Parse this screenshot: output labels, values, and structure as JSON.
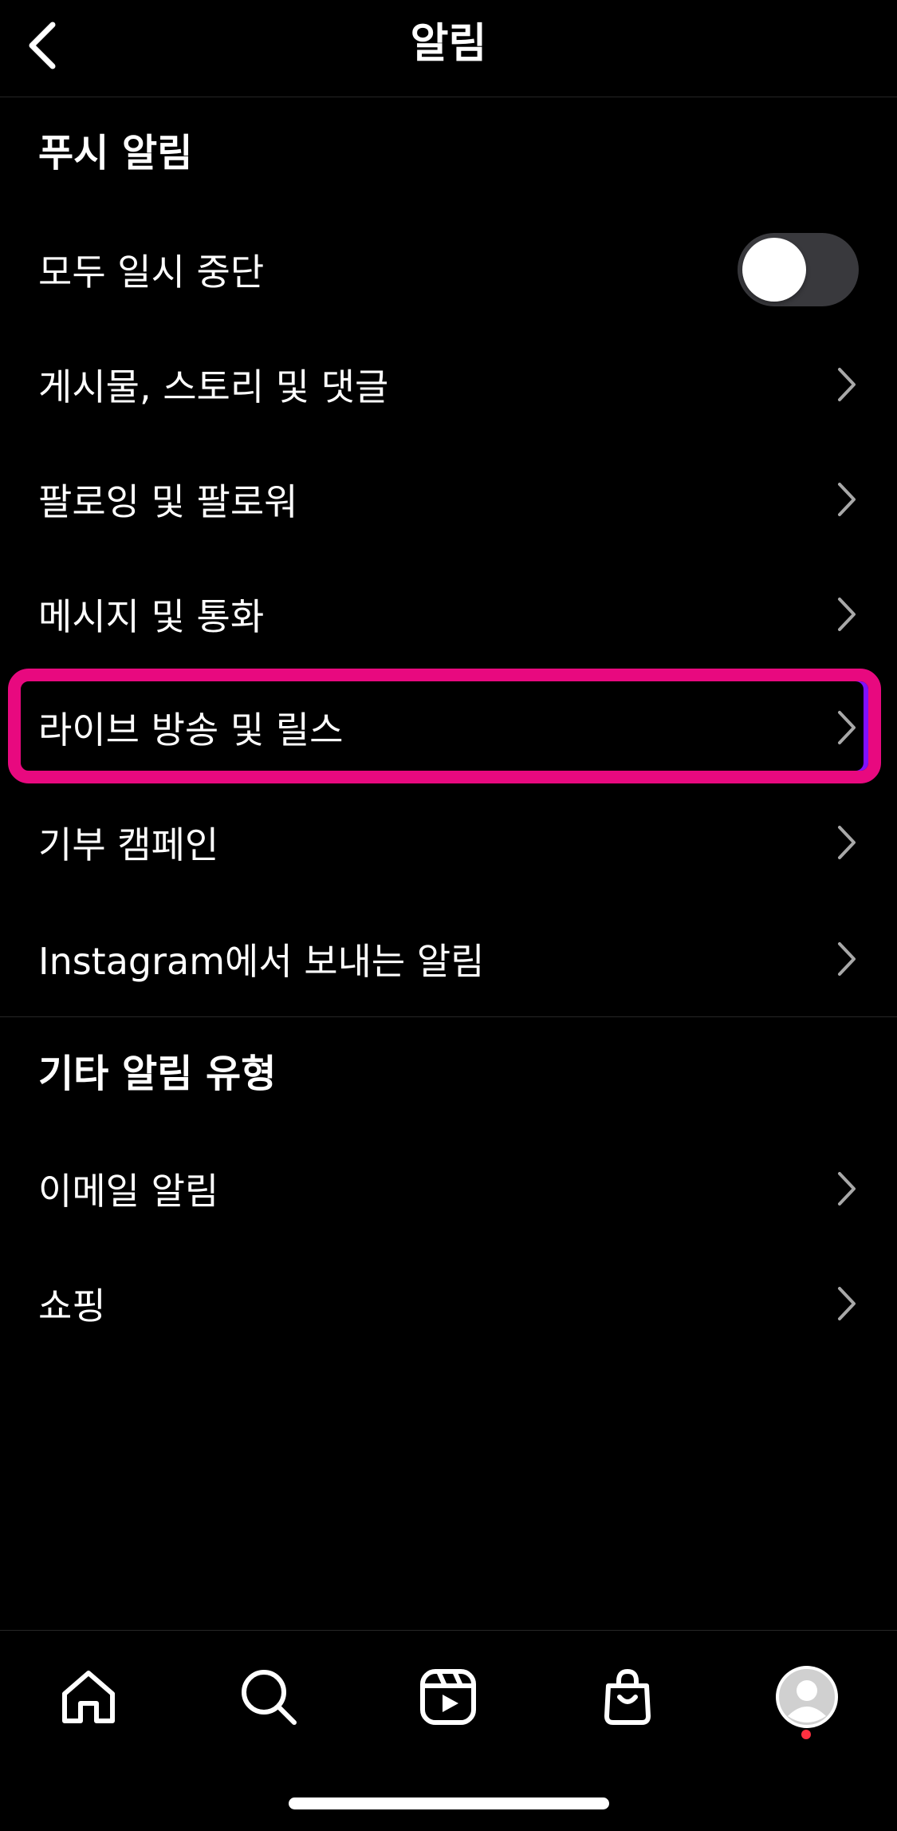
{
  "header": {
    "title": "알림"
  },
  "sections": {
    "push": {
      "title": "푸시 알림",
      "pause_all_label": "모두 일시 중단",
      "pause_all_on": false,
      "items": [
        {
          "label": "게시물, 스토리 및 댓글"
        },
        {
          "label": "팔로잉 및 팔로워"
        },
        {
          "label": "메시지 및 통화"
        },
        {
          "label": "라이브 방송 및 릴스"
        },
        {
          "label": "기부 캠페인"
        },
        {
          "label": "Instagram에서 보내는 알림"
        }
      ]
    },
    "other": {
      "title": "기타 알림 유형",
      "items": [
        {
          "label": "이메일 알림"
        },
        {
          "label": "쇼핑"
        }
      ]
    }
  },
  "tabbar": {
    "tabs": [
      {
        "icon": "home-icon"
      },
      {
        "icon": "search-icon"
      },
      {
        "icon": "reels-icon"
      },
      {
        "icon": "shop-icon"
      },
      {
        "icon": "profile-icon"
      }
    ]
  },
  "colors": {
    "background": "#000000",
    "highlight": "#e8097f",
    "notification_dot": "#ff3040"
  }
}
